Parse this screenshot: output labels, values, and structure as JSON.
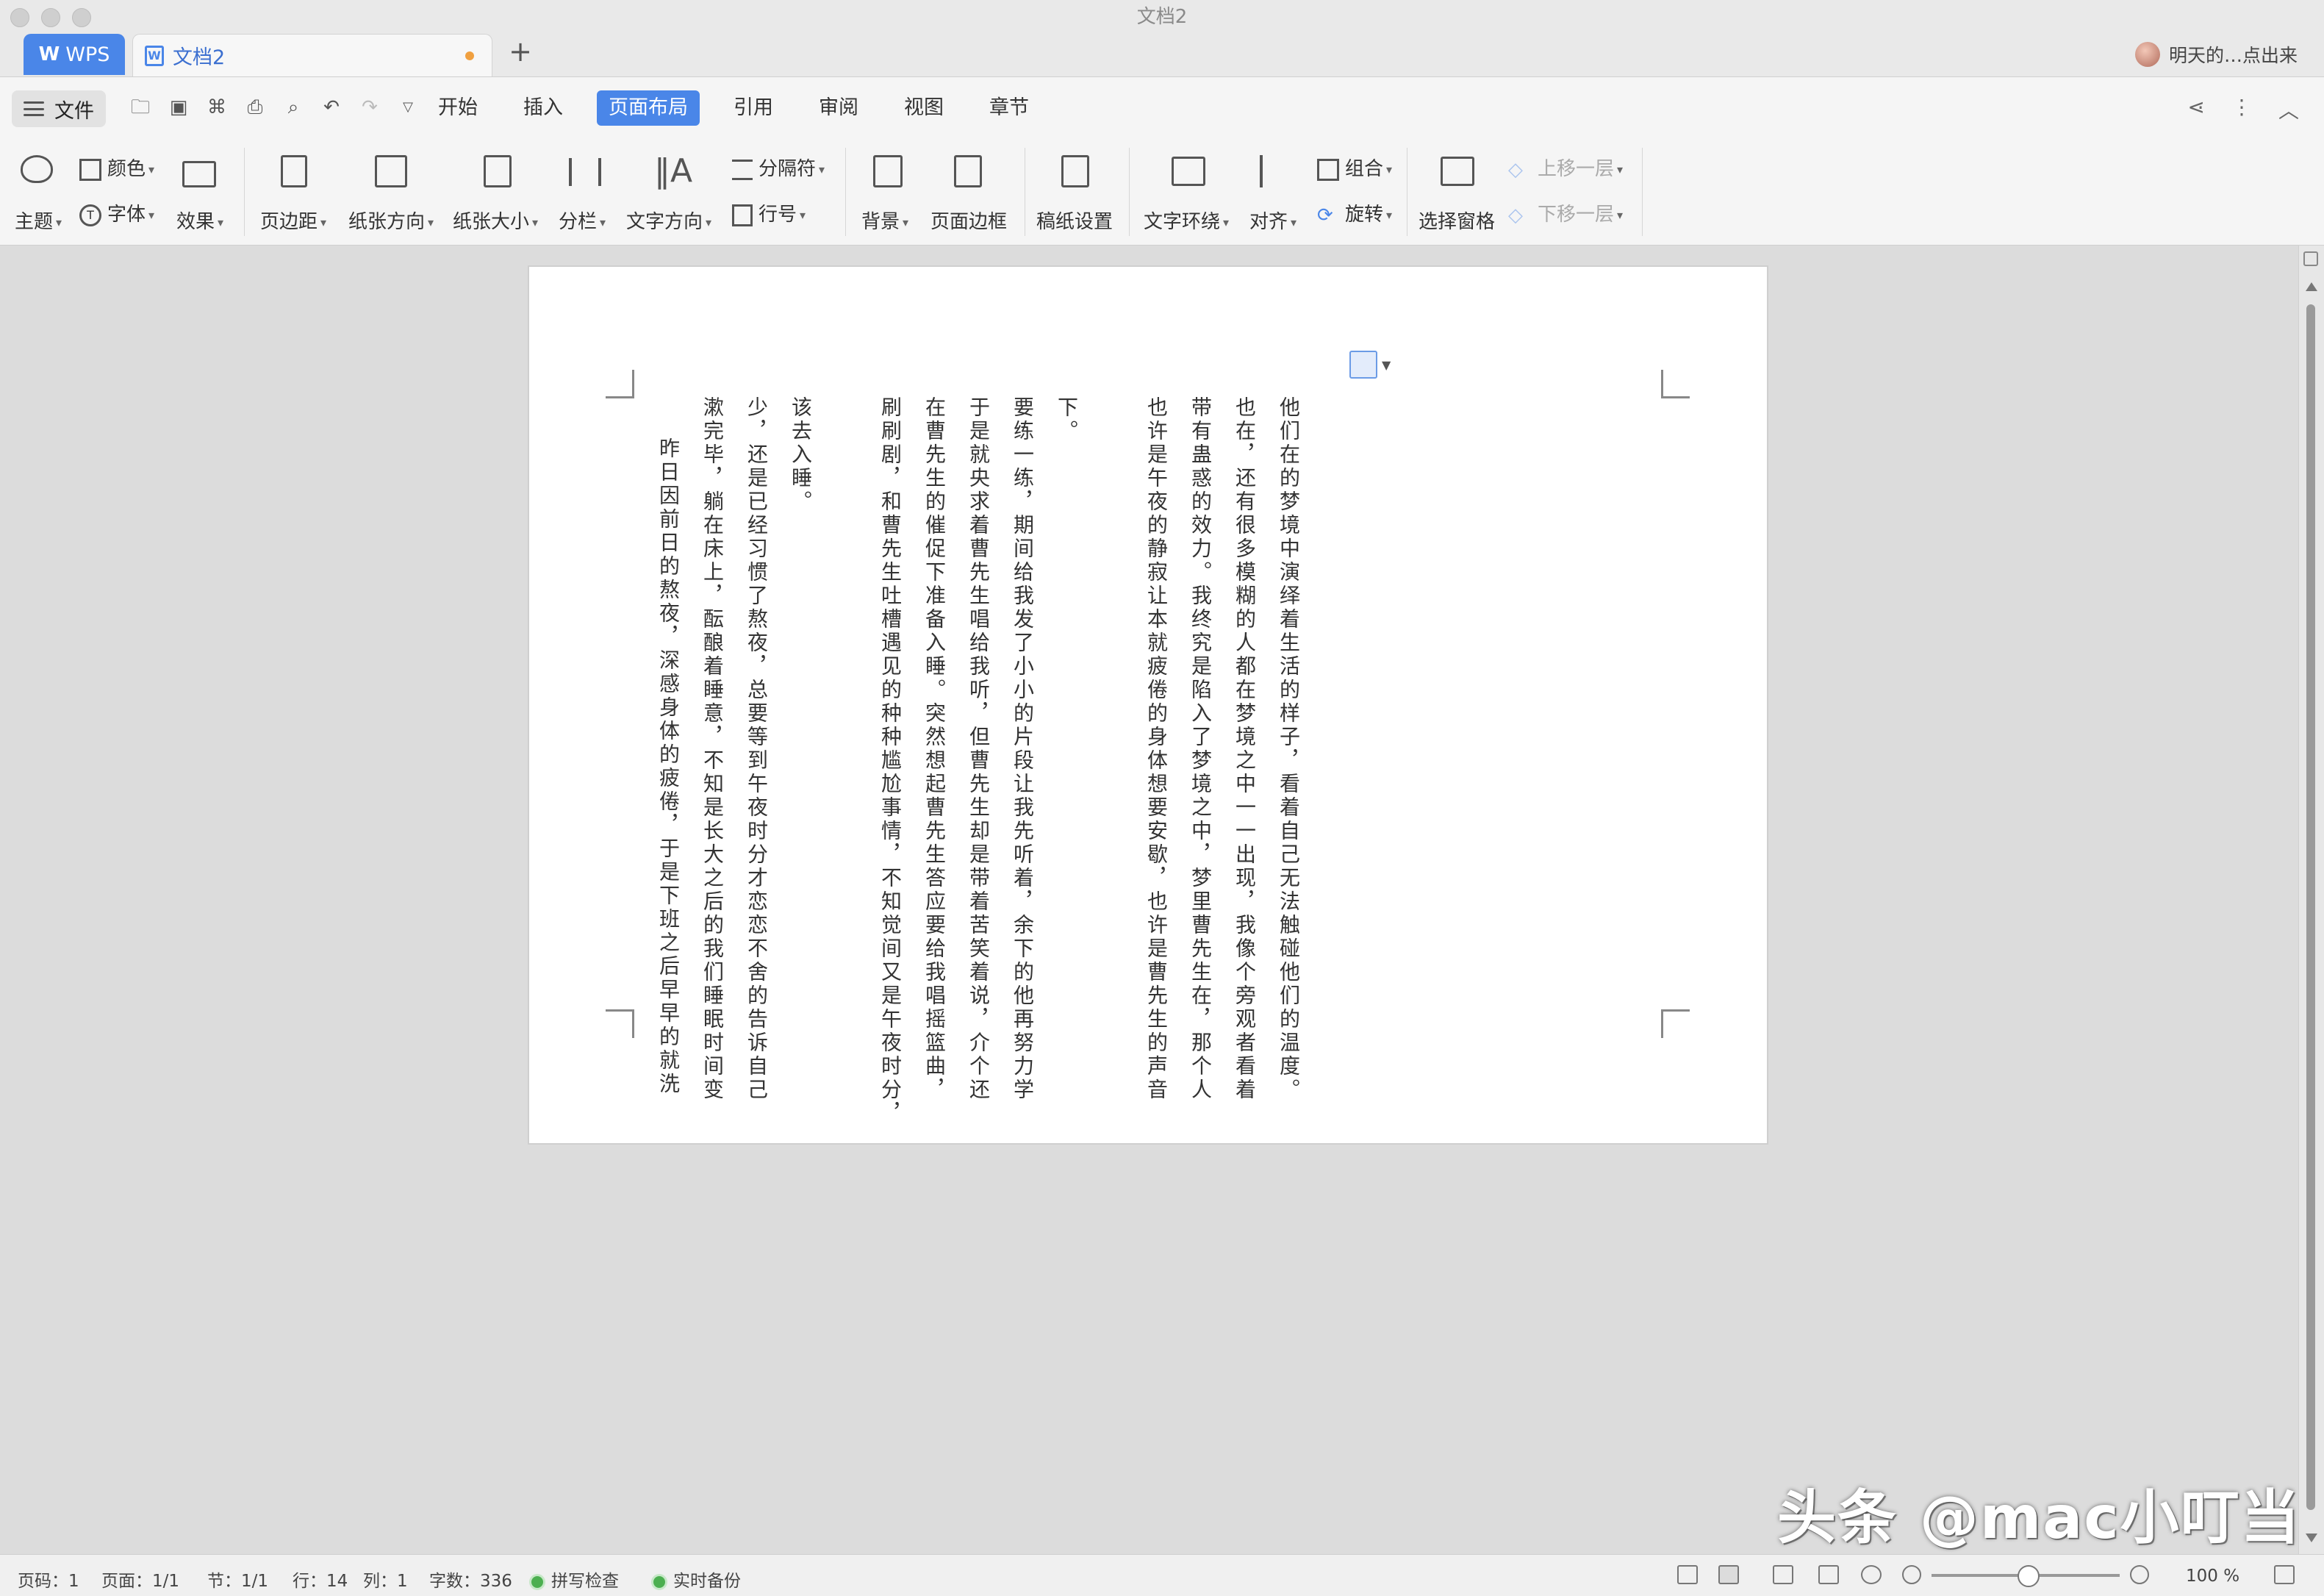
{
  "window": {
    "title": "文档2"
  },
  "tabs": {
    "app_tab": "WPS",
    "doc_tab": "文档2",
    "new_tab": "+",
    "user_name": "明天的…点出来"
  },
  "menubar": {
    "file_label": "文件",
    "tabs": [
      "开始",
      "插入",
      "页面布局",
      "引用",
      "审阅",
      "视图",
      "章节"
    ],
    "active_tab": "页面布局"
  },
  "ribbon": {
    "theme": "主题",
    "color": "颜色",
    "font": "字体",
    "effect": "效果",
    "margins": "页边距",
    "orientation": "纸张方向",
    "paper_size": "纸张大小",
    "columns": "分栏",
    "text_direction": "文字方向",
    "separator": "分隔符",
    "line_numbers": "行号",
    "background": "背景",
    "page_border": "页面边框",
    "manuscript": "稿纸设置",
    "text_wrap": "文字环绕",
    "align": "对齐",
    "group": "组合",
    "rotate": "旋转",
    "selection_pane": "选择窗格",
    "bring_forward": "上移一层",
    "send_backward": "下移一层"
  },
  "document": {
    "columns": [
      "他们在的梦境中演绎着生活的样子，看着自己无法触碰他们的温度。",
      "也在，还有很多模糊的人都在梦境之中一一出现，我像个旁观者看着",
      "带有蛊惑的效力。我终究是陷入了梦境之中，梦里曹先生在，那个人",
      "也许是午夜的静寂让本就疲倦的身体想要安歇，也许是曹先生的声音",
      "下。",
      "要练一练，期间给我发了小小的片段让我先听着，余下的他再努力学",
      "于是就央求着曹先生唱给我听，但曹先生却是带着苦笑着说，介个还",
      "在曹先生的催促下准备入睡。突然想起曹先生答应要给我唱摇篮曲，",
      "刷刷剧，和曹先生吐槽遇见的种种尴尬事情，不知觉间又是午夜时分，",
      "该去入睡。",
      "少，还是已经习惯了熬夜，总要等到午夜时分才恋恋不舍的告诉自己",
      "漱完毕，躺在床上，酝酿着睡意，不知是长大之后的我们睡眠时间变",
      "昨日因前日的熬夜，深感身体的疲倦，于是下班之后早早的就洗"
    ]
  },
  "watermark": "头条 @mac小叮当",
  "statusbar": {
    "page_code": "页码：1",
    "pages": "页面：1/1",
    "section": "节：1/1",
    "row": "行：14",
    "col": "列：1",
    "word_count": "字数：336",
    "spell_check": "拼写检查",
    "backup": "实时备份",
    "zoom": "100 %"
  }
}
